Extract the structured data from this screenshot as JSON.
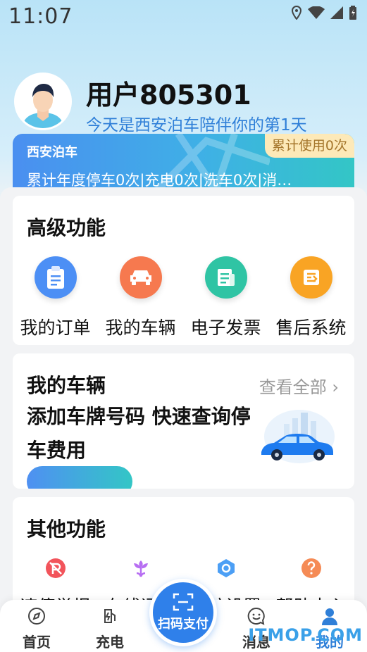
{
  "status_bar": {
    "time": "11:07",
    "icons": [
      "location-icon",
      "wifi-icon",
      "signal-icon",
      "battery-icon"
    ]
  },
  "profile": {
    "username": "用户805301",
    "days_text": "今天是西安泊车陪伴你的第1天"
  },
  "park_card": {
    "title": "西安泊车",
    "usage_badge": "累计使用0次",
    "stats": "累计年度停车0次|充电0次|洗车0次|消…"
  },
  "advanced": {
    "title": "高级功能",
    "items": [
      {
        "label": "我的订单",
        "icon": "clipboard-icon",
        "color": "#4c8ff5"
      },
      {
        "label": "我的车辆",
        "icon": "car-icon",
        "color": "#f6794f"
      },
      {
        "label": "电子发票",
        "icon": "invoice-icon",
        "color": "#2fc4a4"
      },
      {
        "label": "售后系统",
        "icon": "service-icon",
        "color": "#f9a424"
      }
    ]
  },
  "vehicle": {
    "title": "我的车辆",
    "view_all": "查看全部",
    "desc": "添加车牌号码 快速查询停车费用"
  },
  "other": {
    "title": "其他功能",
    "items": [
      {
        "label": "违停举报",
        "icon": "no-parking-icon",
        "color": "#f2545b"
      },
      {
        "label": "在线评价",
        "icon": "flower-icon",
        "color": "#b76ef2"
      },
      {
        "label": "系统设置",
        "icon": "settings-icon",
        "color": "#4c9ff5"
      },
      {
        "label": "帮助中心",
        "icon": "help-icon",
        "color": "#f58b56"
      }
    ]
  },
  "nav": {
    "home": "首页",
    "charge": "充电",
    "scan": "扫码支付",
    "messages": "消息",
    "mine": "我的"
  },
  "watermark": "ITMOP.COM",
  "colors": {
    "accent": "#2f80ea",
    "badge_bg": "#fde9b8"
  }
}
